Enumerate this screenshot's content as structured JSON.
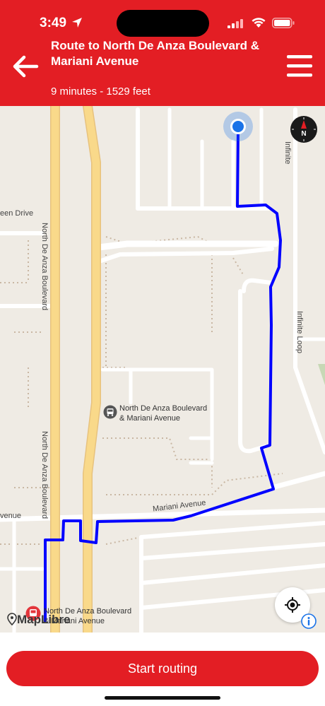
{
  "status_bar": {
    "time": "3:49"
  },
  "header": {
    "title": "Route to North De Anza Boulevard & Mariani Avenue",
    "summary": "9 minutes - 1529 feet"
  },
  "map": {
    "street_labels": {
      "de_anza_north": "North De Anza Boulevard",
      "de_anza_south": "North De Anza Boulevard",
      "green_drive": "een Drive",
      "infinite_loop_top": "Infinite",
      "infinite_loop": "Infinite Loop",
      "mariani_ave": "Mariani Avenue",
      "venue_left": "venue"
    },
    "bus_stop": {
      "line1": "North De Anza Boulevard",
      "line2": "& Mariani Avenue"
    },
    "rail_stop": {
      "line1": "North De Anza Boulevard",
      "line2": "& Mariani Avenue"
    },
    "attribution": "MapLibre",
    "compass_letter": "N",
    "colors": {
      "route": "#0000ff",
      "user_location": "#1a73e8",
      "arterial": "#f9d98a"
    }
  },
  "actions": {
    "start_routing": "Start routing"
  },
  "theme": {
    "primary": "#e31e24"
  }
}
